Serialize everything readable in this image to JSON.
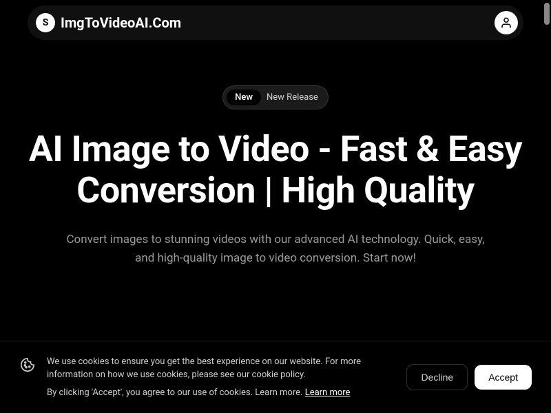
{
  "header": {
    "logo_letter": "S",
    "brand": "ImgToVideoAI.Com"
  },
  "hero": {
    "badge_pill": "New",
    "badge_text": "New Release",
    "title": "AI Image to Video - Fast & Easy Conversion | High Quality",
    "subtitle": "Convert images to stunning videos with our advanced AI technology. Quick, easy, and high-quality image to video conversion. Start now!"
  },
  "cookie": {
    "message_line1": "We use cookies to ensure you get the best experience on our website. For more information on how we use cookies, please see our cookie policy.",
    "message_line2_prefix": "By clicking 'Accept', you agree to our use of cookies. Learn more. ",
    "learn_more": "Learn more",
    "decline": "Decline",
    "accept": "Accept"
  }
}
